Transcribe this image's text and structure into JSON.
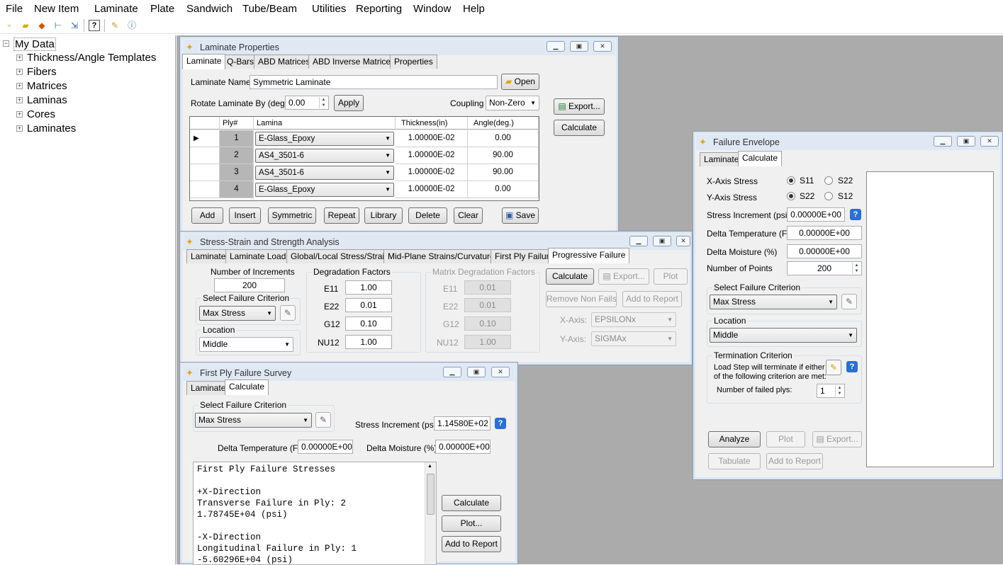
{
  "menu": [
    "File",
    "New Item",
    "Laminate",
    "Plate",
    "Sandwich",
    "Tube/Beam",
    "Utilities",
    "Reporting",
    "Window",
    "Help"
  ],
  "toolbar_icons": [
    "new-file-icon",
    "open-folder-icon",
    "import-icon",
    "tree-icon",
    "export-icon",
    "help-icon",
    "tools-icon",
    "about-icon"
  ],
  "tree": {
    "root": "My Data",
    "items": [
      "Thickness/Angle Templates",
      "Fibers",
      "Matrices",
      "Laminas",
      "Cores",
      "Laminates"
    ]
  },
  "laminate_props": {
    "title": "Laminate Properties",
    "tabs": [
      "Laminate",
      "Q-Bars",
      "ABD Matrices",
      "ABD Inverse Matrices",
      "Properties"
    ],
    "name_label": "Laminate Name:",
    "name_value": "Symmetric Laminate",
    "open_label": "Open",
    "rotate_label": "Rotate Laminate By (deg.)",
    "rotate_value": "0.00",
    "apply_label": "Apply",
    "coupling_label": "Coupling",
    "coupling_value": "Non-Zero",
    "export_label": "Export...",
    "calculate_label": "Calculate",
    "columns": [
      "Ply#",
      "Lamina",
      "Thickness(in)",
      "Angle(deg.)"
    ],
    "rows": [
      {
        "ply": "1",
        "lamina": "E-Glass_Epoxy",
        "thickness": "1.00000E-02",
        "angle": "0.00"
      },
      {
        "ply": "2",
        "lamina": "AS4_3501-6",
        "thickness": "1.00000E-02",
        "angle": "90.00"
      },
      {
        "ply": "3",
        "lamina": "AS4_3501-6",
        "thickness": "1.00000E-02",
        "angle": "90.00"
      },
      {
        "ply": "4",
        "lamina": "E-Glass_Epoxy",
        "thickness": "1.00000E-02",
        "angle": "0.00"
      }
    ],
    "buttons": [
      "Add",
      "Insert",
      "Symmetric",
      "Repeat",
      "Library",
      "Delete",
      "Clear"
    ],
    "save_label": "Save"
  },
  "stress_strain": {
    "title": "Stress-Strain and Strength Analysis",
    "tabs": [
      "Laminate",
      "Laminate Loads",
      "Global/Local Stress/Strain",
      "Mid-Plane Strains/Curvatures",
      "First Ply Failure",
      "Progressive Failure"
    ],
    "num_increments_label": "Number of Increments",
    "num_increments_value": "200",
    "failure_criterion_label": "Select Failure Criterion",
    "failure_criterion_value": "Max Stress",
    "location_label": "Location",
    "location_value": "Middle",
    "degradation_label": "Degradation Factors",
    "degradation": [
      {
        "name": "E11",
        "value": "1.00"
      },
      {
        "name": "E22",
        "value": "0.01"
      },
      {
        "name": "G12",
        "value": "0.10"
      },
      {
        "name": "NU12",
        "value": "1.00"
      }
    ],
    "matrix_degradation_label": "Matrix Degradation Factors",
    "matrix_degradation": [
      {
        "name": "E11",
        "value": "0.01"
      },
      {
        "name": "E22",
        "value": "0.01"
      },
      {
        "name": "G12",
        "value": "0.10"
      },
      {
        "name": "NU12",
        "value": "1.00"
      }
    ],
    "calculate_label": "Calculate",
    "export_label": "Export...",
    "plot_label": "Plot",
    "remove_label": "Remove Non Fails",
    "add_report_label": "Add to Report",
    "x_axis_label": "X-Axis:",
    "x_axis_value": "EPSILONx",
    "y_axis_label": "Y-Axis:",
    "y_axis_value": "SIGMAx"
  },
  "first_ply": {
    "title": "First Ply Failure Survey",
    "tabs": [
      "Laminate",
      "Calculate"
    ],
    "failure_criterion_label": "Select Failure Criterion",
    "failure_criterion_value": "Max Stress",
    "stress_inc_label": "Stress Increment (psi)",
    "stress_inc_value": "1.14580E+02",
    "delta_temp_label": "Delta Temperature (F)",
    "delta_temp_value": "0.00000E+00",
    "delta_moist_label": "Delta Moisture (%)",
    "delta_moist_value": "0.00000E+00",
    "results": [
      "First Ply Failure Stresses",
      "",
      "+X-Direction",
      "Transverse Failure in Ply: 2",
      "1.78745E+04 (psi)",
      "",
      "-X-Direction",
      "Longitudinal Failure in Ply: 1",
      "-5.60296E+04 (psi)"
    ],
    "calculate_label": "Calculate",
    "plot_label": "Plot...",
    "add_report_label": "Add to Report"
  },
  "failure_env": {
    "title": "Failure Envelope",
    "tabs": [
      "Laminate",
      "Calculate"
    ],
    "x_axis_label": "X-Axis Stress",
    "x_opt1": "S11",
    "x_opt2": "S22",
    "y_axis_label": "Y-Axis Stress",
    "y_opt1": "S22",
    "y_opt2": "S12",
    "stress_inc_label": "Stress Increment (psi)",
    "stress_inc_value": "0.00000E+00",
    "delta_temp_label": "Delta Temperature (F)",
    "delta_temp_value": "0.00000E+00",
    "delta_moist_label": "Delta Moisture (%)",
    "delta_moist_value": "0.00000E+00",
    "num_points_label": "Number of Points",
    "num_points_value": "200",
    "failure_criterion_label": "Select Failure Criterion",
    "failure_criterion_value": "Max Stress",
    "location_label": "Location",
    "location_value": "Middle",
    "termination_label": "Termination Criterion",
    "termination_text1": "Load Step will terminate if either",
    "termination_text2": "of the following criterion are met:",
    "failed_plys_label": "Number of failed plys:",
    "failed_plys_value": "1",
    "analyze_label": "Analyze",
    "plot_label": "Plot",
    "export_label": "Export...",
    "tabulate_label": "Tabulate",
    "add_report_label": "Add to Report"
  }
}
